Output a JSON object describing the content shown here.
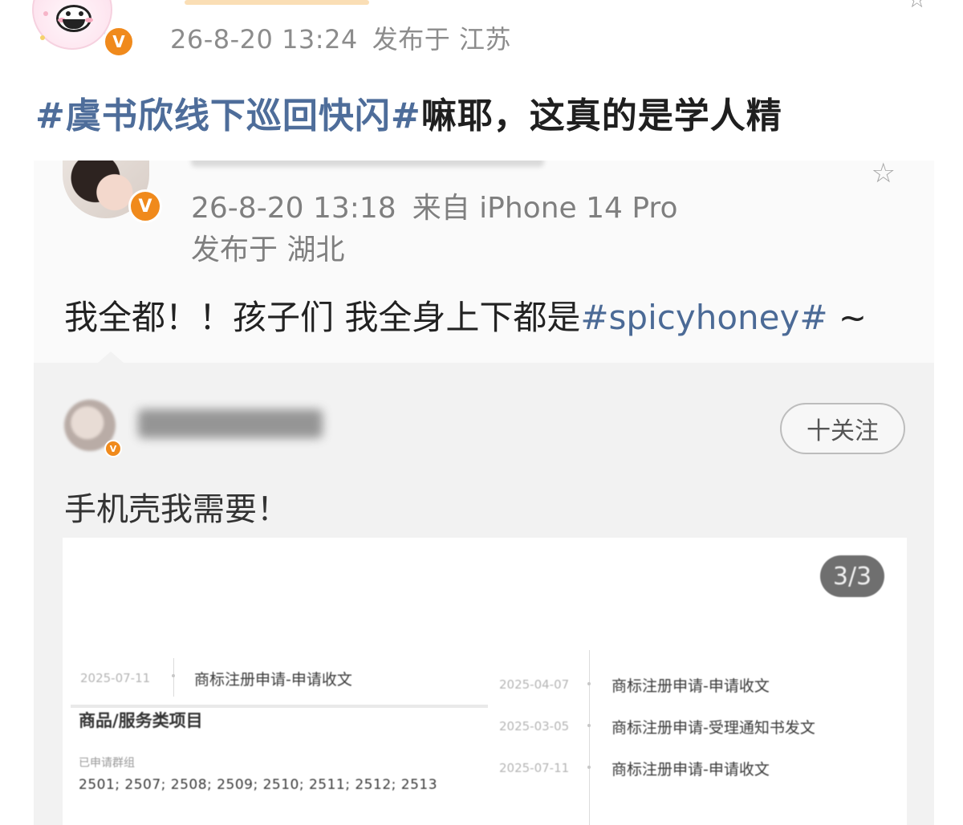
{
  "outer_post": {
    "timestamp": "26-8-20 13:24",
    "location": "发布于 江苏",
    "text": {
      "hashtag": "#虞书欣线下巡回快闪#",
      "body": "嘛耶，这真的是学人精"
    },
    "verified_badge": "V",
    "star_icon": "☆"
  },
  "screenshot": {
    "timestamp": "26-8-20 13:18",
    "source": "来自 iPhone 14 Pro",
    "location": "发布于 湖北",
    "text": {
      "before": "我全都！！孩子们 我全身上下都是",
      "hashtag": "#spicyhoney#",
      "after": " ~"
    },
    "verified_badge": "V",
    "star_icon": "☆",
    "repost": {
      "follow_label": "十关注",
      "text": "手机壳我需要！",
      "verified_badge": "V",
      "image": {
        "pager": "3/3",
        "left_entry": {
          "date": "2025-07-11",
          "label": "商标注册申请-申请收文"
        },
        "section_title": "商品/服务类项目",
        "section_sub": "已申请群组",
        "codes": "2501; 2507; 2508; 2509; 2510; 2511; 2512; 2513",
        "right_entries": [
          {
            "date": "2025-04-07",
            "label": "商标注册申请-申请收文"
          },
          {
            "date": "2025-03-05",
            "label": "商标注册申请-受理通知书发文"
          },
          {
            "date": "2025-07-11",
            "label": "商标注册申请-申请收文"
          }
        ]
      }
    }
  }
}
